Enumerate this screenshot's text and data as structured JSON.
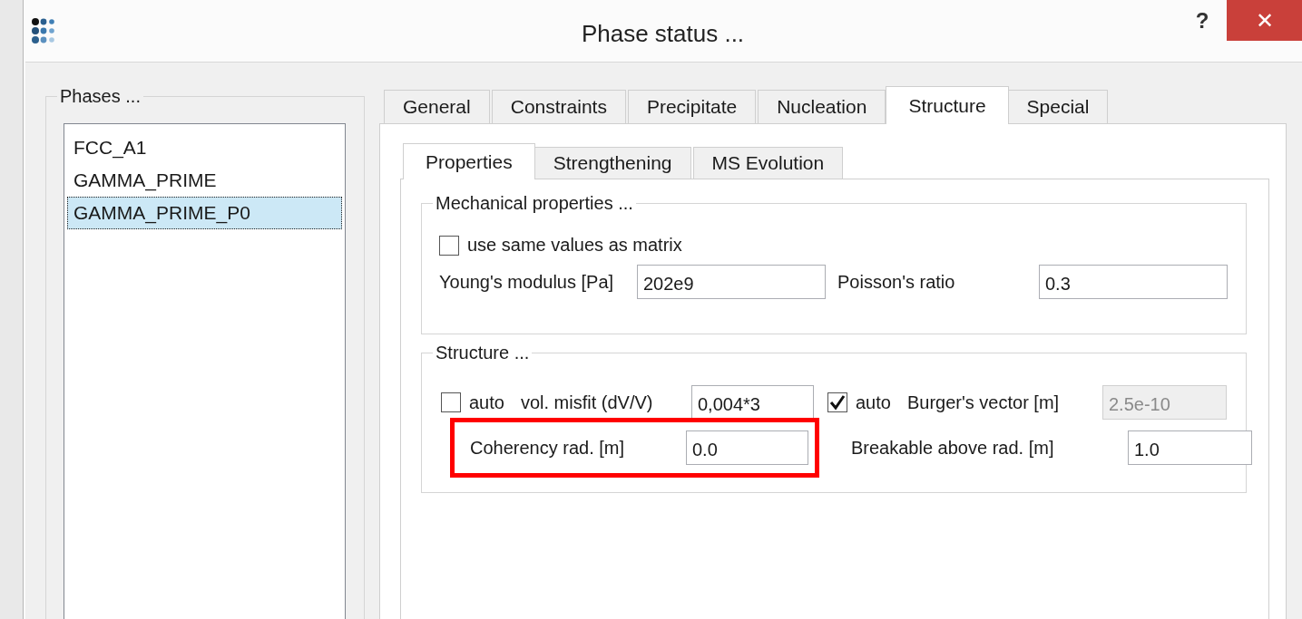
{
  "window": {
    "title": "Phase status ...",
    "buttons": [
      {
        "kind": "help",
        "label": "?"
      },
      {
        "kind": "close",
        "label": "✕"
      }
    ]
  },
  "phases": {
    "title": "Phases ...",
    "items": [
      {
        "label": "FCC_A1",
        "selected": false
      },
      {
        "label": "GAMMA_PRIME",
        "selected": false
      },
      {
        "label": "GAMMA_PRIME_P0",
        "selected": true
      }
    ]
  },
  "tabs": [
    {
      "label": "General",
      "selected": false
    },
    {
      "label": "Constraints",
      "selected": false
    },
    {
      "label": "Precipitate",
      "selected": false
    },
    {
      "label": "Nucleation",
      "selected": false
    },
    {
      "label": "Structure",
      "selected": true
    },
    {
      "label": "Special",
      "selected": false
    }
  ],
  "subtabs": [
    {
      "label": "Properties",
      "selected": true
    },
    {
      "label": "Strengthening",
      "selected": false
    },
    {
      "label": "MS Evolution",
      "selected": false
    }
  ],
  "mechanical": {
    "title": "Mechanical properties ...",
    "same_as_matrix": {
      "label": "use same values as matrix",
      "checked": false
    },
    "youngs": {
      "label": "Young's modulus [Pa]",
      "value": "202e9"
    },
    "poisson": {
      "label": "Poisson's ratio",
      "value": "0.3"
    }
  },
  "structure": {
    "title": "Structure ...",
    "misfit": {
      "auto": {
        "label": "auto",
        "checked": false
      },
      "label": "vol. misfit (dV/V)",
      "value": "0,004*3",
      "disabled": false
    },
    "burgers": {
      "auto": {
        "label": "auto",
        "checked": true
      },
      "label": "Burger's vector [m]",
      "value": "2.5e-10",
      "disabled": true
    },
    "coherency": {
      "label": "Coherency rad. [m]",
      "value": "0.0",
      "highlighted": true
    },
    "breakable": {
      "label": "Breakable above rad. [m]",
      "value": "1.0"
    }
  }
}
